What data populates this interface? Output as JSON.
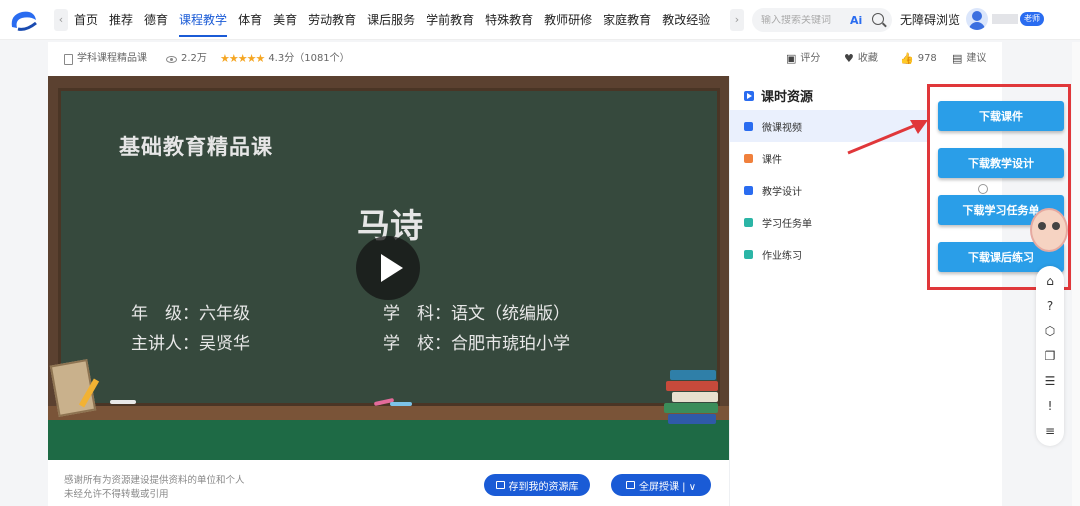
{
  "nav": {
    "items": [
      "首页",
      "推荐",
      "德育",
      "课程教学",
      "体育",
      "美育",
      "劳动教育",
      "课后服务",
      "学前教育",
      "特殊教育",
      "教师研修",
      "家庭教育",
      "教改经验"
    ],
    "active_index": 3,
    "search_placeholder": "输入搜索关键词",
    "ai_label": "Ai",
    "accessible_label": "无障碍浏览",
    "teacher_badge": "老师",
    "prev_arrow": "‹",
    "next_arrow": "›"
  },
  "info": {
    "course_type": "学科课程精品课",
    "views": "2.2万",
    "rating_text": "4.3分（1081个）",
    "rating_value": 4.3,
    "stars": "★★★★★",
    "rate_label": "评分",
    "collect_label": "收藏",
    "likes": "978",
    "suggest_label": "建议",
    "rate_icon": "▣",
    "collect_icon": "♥",
    "like_icon": "👍",
    "suggest_icon": "▤"
  },
  "video": {
    "board_title": "基础教育精品课",
    "lesson_title": "马诗",
    "grade_line": "年　级：六年级",
    "subject_line": "学　科：语文（统编版）",
    "teacher_line": "主讲人：吴贤华",
    "school_line": "学　校：合肥市琥珀小学"
  },
  "bottom": {
    "thanks_line1": "感谢所有为资源建设提供资料的单位和个人",
    "thanks_line2": "未经允许不得转载或引用",
    "save_label": "存到我的资源库",
    "fullscreen_label": "全屏授课 | ∨"
  },
  "resources": {
    "title": "课时资源",
    "items": [
      {
        "label": "微课视频",
        "color": "#2a6cf0"
      },
      {
        "label": "课件",
        "color": "#f0803c"
      },
      {
        "label": "教学设计",
        "color": "#2a6cf0"
      },
      {
        "label": "学习任务单",
        "color": "#2bb5a6"
      },
      {
        "label": "作业练习",
        "color": "#2bb5a6"
      }
    ],
    "active_index": 0
  },
  "downloads": {
    "courseware": "下载课件",
    "design": "下载教学设计",
    "task_sheet": "下载学习任务单",
    "exercise": "下载课后练习"
  },
  "rail": {
    "icons": [
      "home-icon",
      "help-icon",
      "cube-icon",
      "copy-icon",
      "note-icon",
      "feedback-icon",
      "menu-icon"
    ],
    "glyphs": [
      "⌂",
      "?",
      "⬡",
      "❐",
      "☰",
      "!",
      "≡"
    ]
  },
  "colors": {
    "brand": "#1a5bd6",
    "download_button": "#2a9ee8",
    "highlight_box": "#e0373a",
    "chalkboard": "#36493d"
  }
}
